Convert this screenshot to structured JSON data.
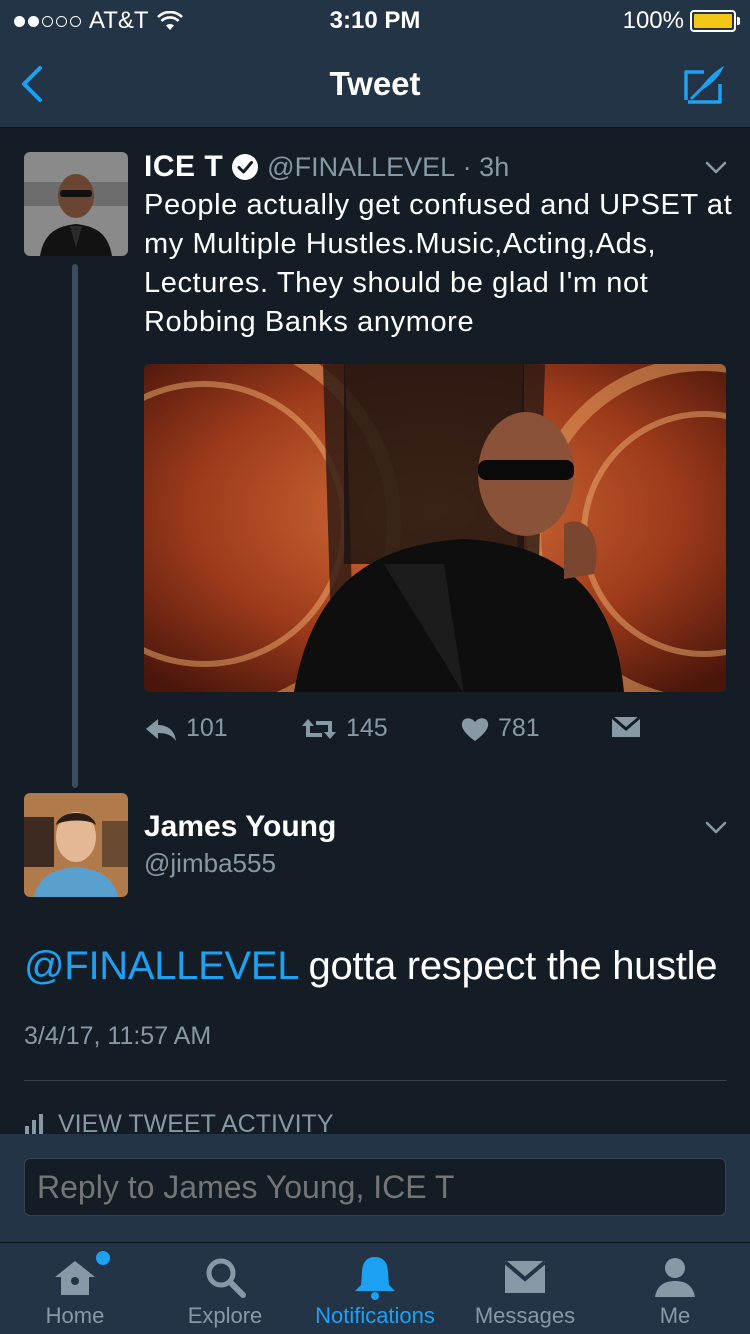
{
  "status_bar": {
    "carrier": "AT&T",
    "time": "3:10 PM",
    "battery": "100%",
    "battery_level": 1.0
  },
  "nav": {
    "title": "Tweet"
  },
  "tweet": {
    "author_name": "ICE T",
    "author_handle": "@FINALLEVEL",
    "age": "3h",
    "text": "People actually get confused and UPSET at my Multiple Hustles.Music,Acting,Ads, Lectures. They should be glad I'm not Robbing Banks anymore",
    "replies": "101",
    "retweets": "145",
    "likes": "781"
  },
  "reply": {
    "author_name": "James Young",
    "author_handle": "@jimba555",
    "mention": "@FINALLEVEL",
    "text": " gotta respect the hustle",
    "timestamp": "3/4/17, 11:57 AM",
    "activity_label": "VIEW TWEET ACTIVITY"
  },
  "composer": {
    "placeholder": "Reply to James Young, ICE T"
  },
  "tabs": [
    {
      "label": "Home",
      "icon": "home-icon"
    },
    {
      "label": "Explore",
      "icon": "search-icon"
    },
    {
      "label": "Notifications",
      "icon": "bell-icon"
    },
    {
      "label": "Messages",
      "icon": "envelope-icon"
    },
    {
      "label": "Me",
      "icon": "person-icon"
    }
  ],
  "colors": {
    "accent": "#1da1f2",
    "background": "#141d26",
    "bar": "#243447",
    "muted": "#8899a6",
    "battery": "#f5c518"
  }
}
